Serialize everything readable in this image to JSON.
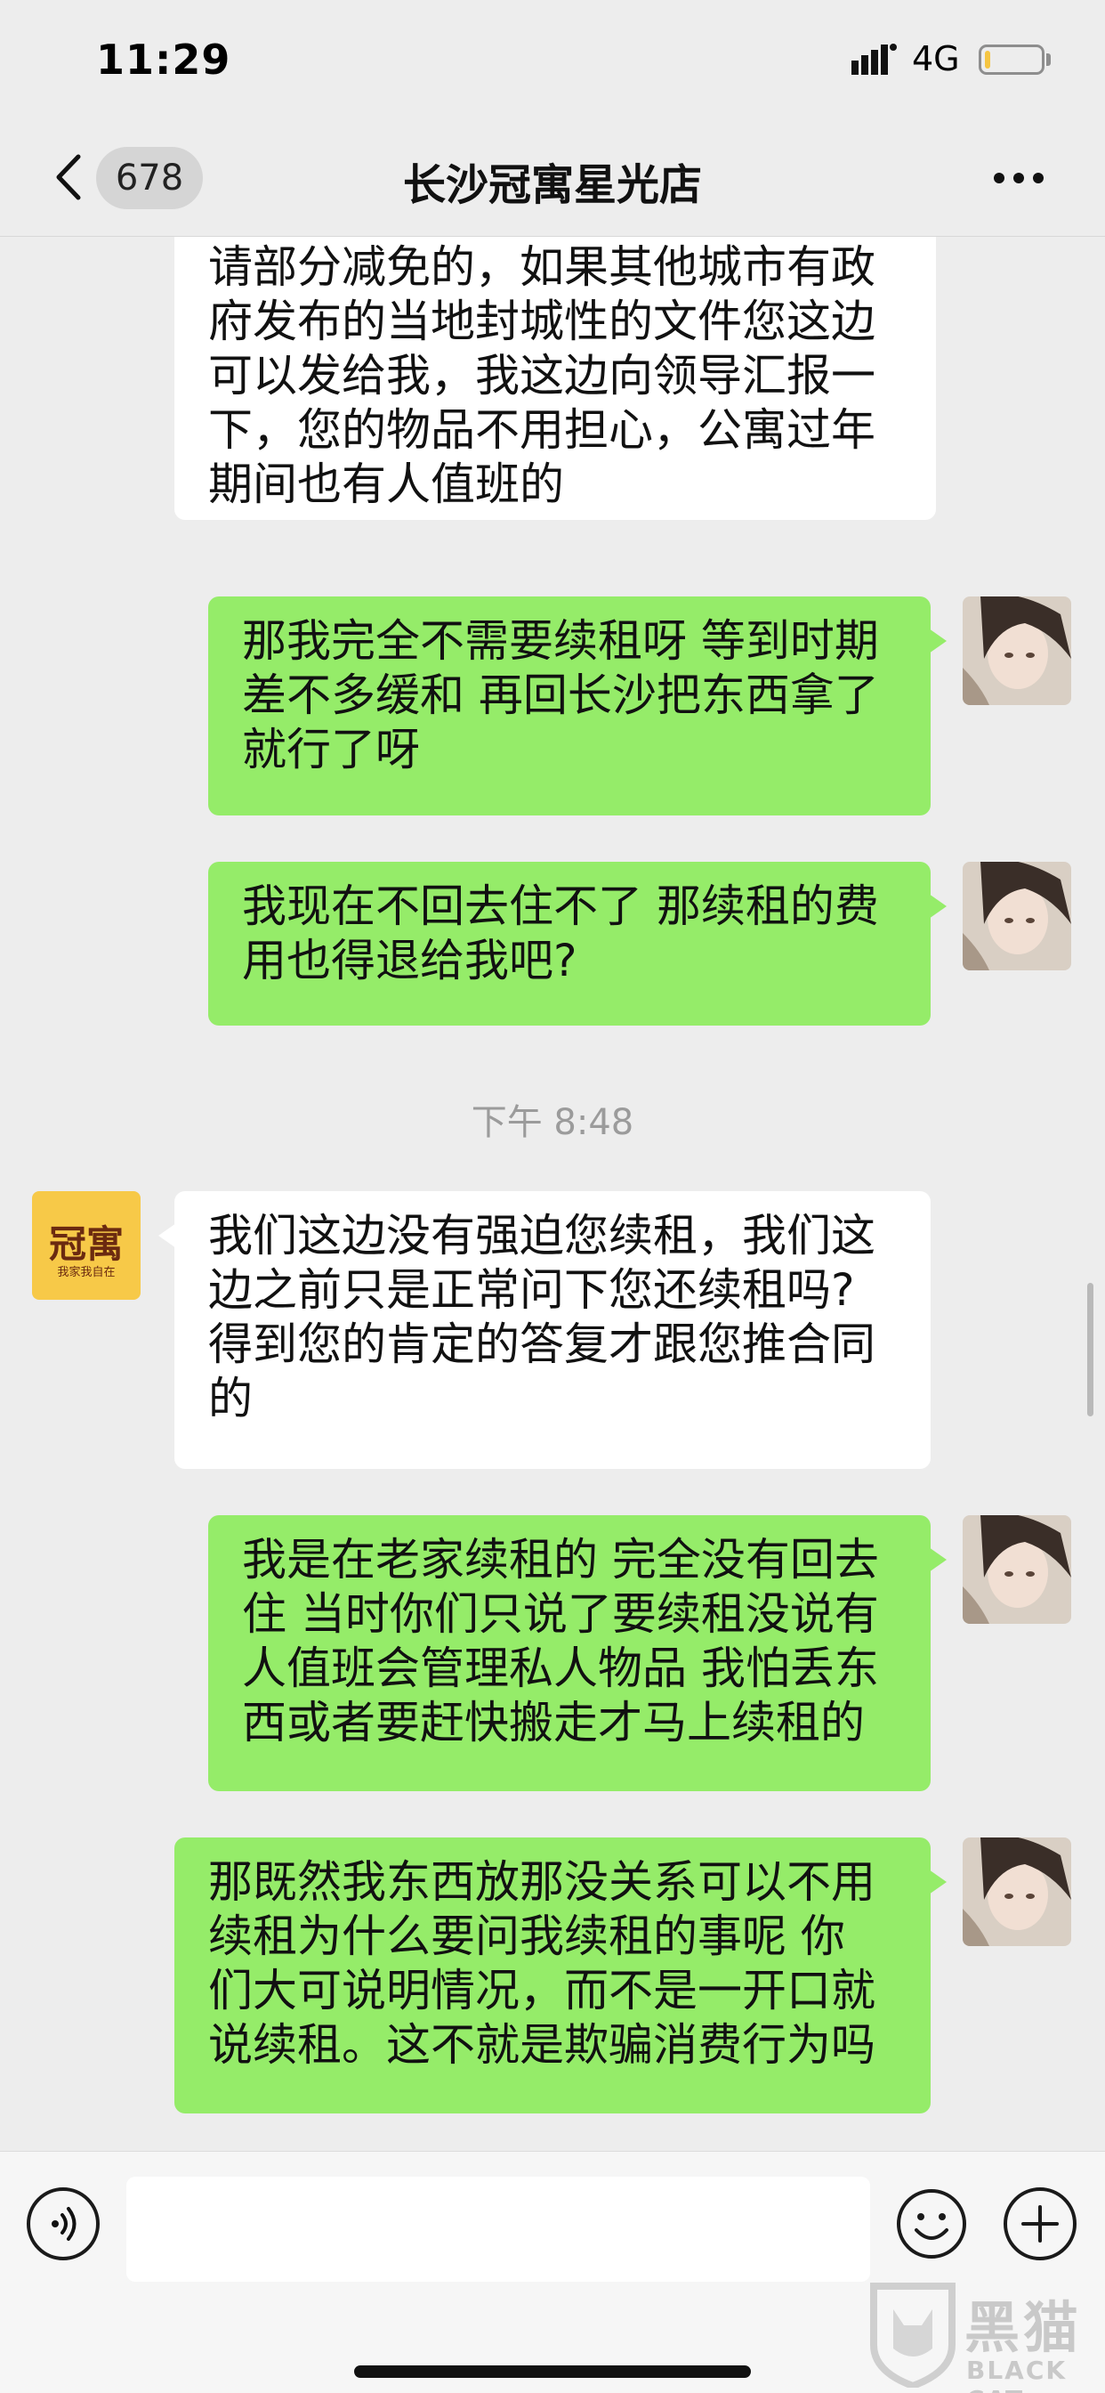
{
  "status_bar": {
    "time": "11:29",
    "network": "4G",
    "battery_level": 0.1,
    "battery_color": "#f5c542"
  },
  "nav": {
    "back_icon": "chevron-left-icon",
    "unread_count": "678",
    "title": "长沙冠寓星光店",
    "more_icon": "ellipsis-icon"
  },
  "messages": [
    {
      "sender": "shop",
      "lines": [
        "请部分减免的，如果其他城市有政",
        "府发布的当地封城性的文件您这边",
        "可以发给我，我这边向领导汇报一",
        "下，您的物品不用担心，公寓过年",
        "期间也有人值班的"
      ]
    },
    {
      "sender": "me",
      "lines": [
        "那我完全不需要续租呀 等到时期",
        "差不多缓和 再回长沙把东西拿了",
        "就行了呀"
      ]
    },
    {
      "sender": "me",
      "lines": [
        "我现在不回去住不了 那续租的费",
        "用也得退给我吧?"
      ]
    },
    {
      "sender": "shop",
      "lines": [
        "我们这边没有强迫您续租，我们这",
        "边之前只是正常问下您还续租吗?",
        "得到您的肯定的答复才跟您推合同",
        "的"
      ]
    },
    {
      "sender": "me",
      "lines": [
        "我是在老家续租的 完全没有回去",
        "住 当时你们只说了要续租没说有",
        "人值班会管理私人物品 我怕丢东",
        "西或者要赶快搬走才马上续租的"
      ]
    },
    {
      "sender": "me",
      "lines": [
        "那既然我东西放那没关系可以不用",
        "续租为什么要问我续租的事呢 你",
        "们大可说明情况，而不是一开口就",
        "说续租。这不就是欺骗消费行为吗"
      ]
    }
  ],
  "timestamp": "下午 8:48",
  "shop_avatar": {
    "logo_text": "冠寓",
    "sub_text": "我家我自在",
    "color": "#f7c948"
  },
  "input_bar": {
    "voice_icon": "voice-icon",
    "emoji_icon": "smiley-icon",
    "plus_icon": "plus-icon",
    "input_value": ""
  },
  "watermark": {
    "title": "黑猫",
    "sub": "BLACK CAT"
  },
  "colors": {
    "my_bubble": "#95ec69",
    "their_bubble": "#ffffff",
    "background": "#ededed"
  }
}
